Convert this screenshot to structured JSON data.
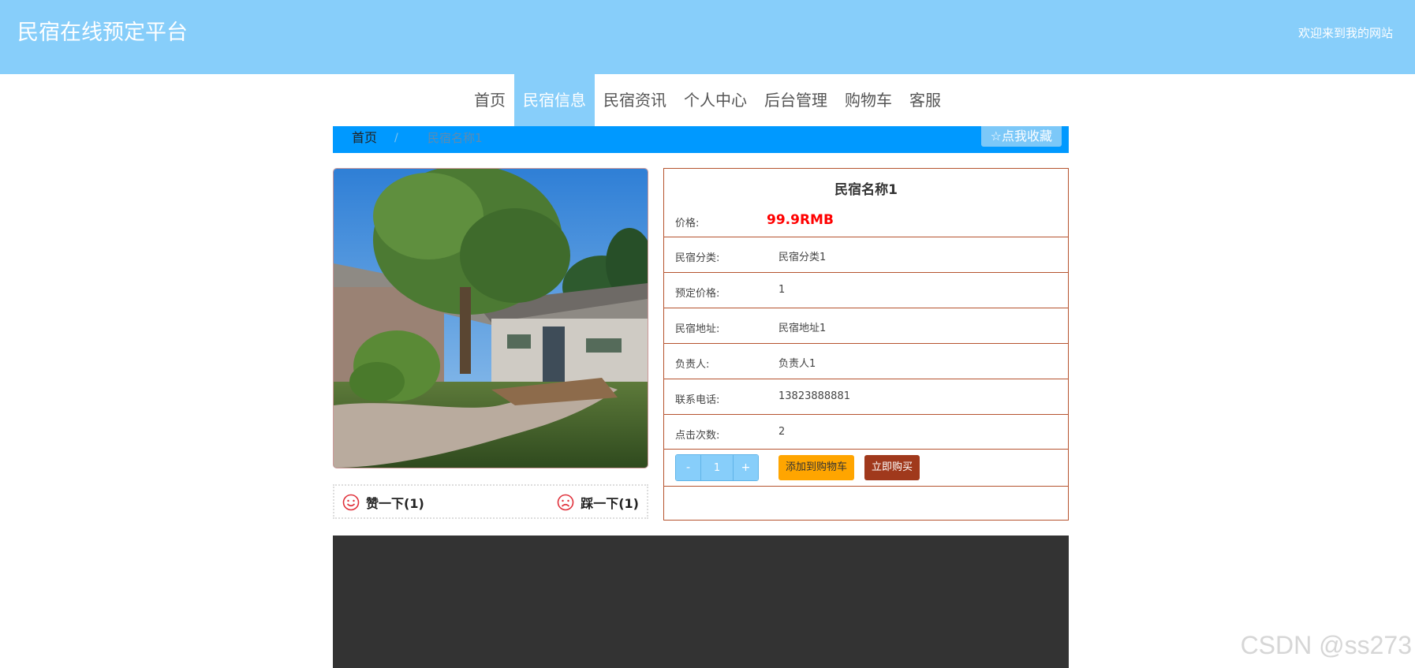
{
  "header": {
    "site_title": "民宿在线预定平台",
    "welcome": "欢迎来到我的网站"
  },
  "nav": {
    "items": [
      {
        "label": "首页"
      },
      {
        "label": "民宿信息",
        "active": true
      },
      {
        "label": "民宿资讯"
      },
      {
        "label": "个人中心"
      },
      {
        "label": "后台管理"
      },
      {
        "label": "购物车"
      },
      {
        "label": "客服"
      }
    ]
  },
  "breadcrumb": {
    "home": "首页",
    "separator": "/",
    "current": "民宿名称1",
    "favorite_label": "☆点我收藏"
  },
  "votes": {
    "like_label": "赞一下(1)",
    "dislike_label": "踩一下(1)"
  },
  "detail": {
    "title": "民宿名称1",
    "price_label": "价格:",
    "price_value": "99.9RMB",
    "rows": [
      {
        "label": "民宿分类:",
        "value": "民宿分类1"
      },
      {
        "label": "预定价格:",
        "value": "1"
      },
      {
        "label": "民宿地址:",
        "value": "民宿地址1"
      },
      {
        "label": "负责人:",
        "value": "负责人1"
      },
      {
        "label": "联系电话:",
        "value": "13823888881"
      },
      {
        "label": "点击次数:",
        "value": "2"
      }
    ],
    "qty_minus": "-",
    "qty_value": "1",
    "qty_plus": "+",
    "add_to_cart": "添加到购物车",
    "buy_now": "立即购买"
  },
  "watermark": "CSDN @ss273",
  "colors": {
    "header_bg": "#87cefa",
    "breadcrumb_bg": "#0099ff",
    "border_accent": "#b5532e",
    "price": "#ff0000",
    "add_cart_bg": "#ffa500",
    "buy_now_bg": "#a0391c",
    "footer_bg": "#333333"
  }
}
